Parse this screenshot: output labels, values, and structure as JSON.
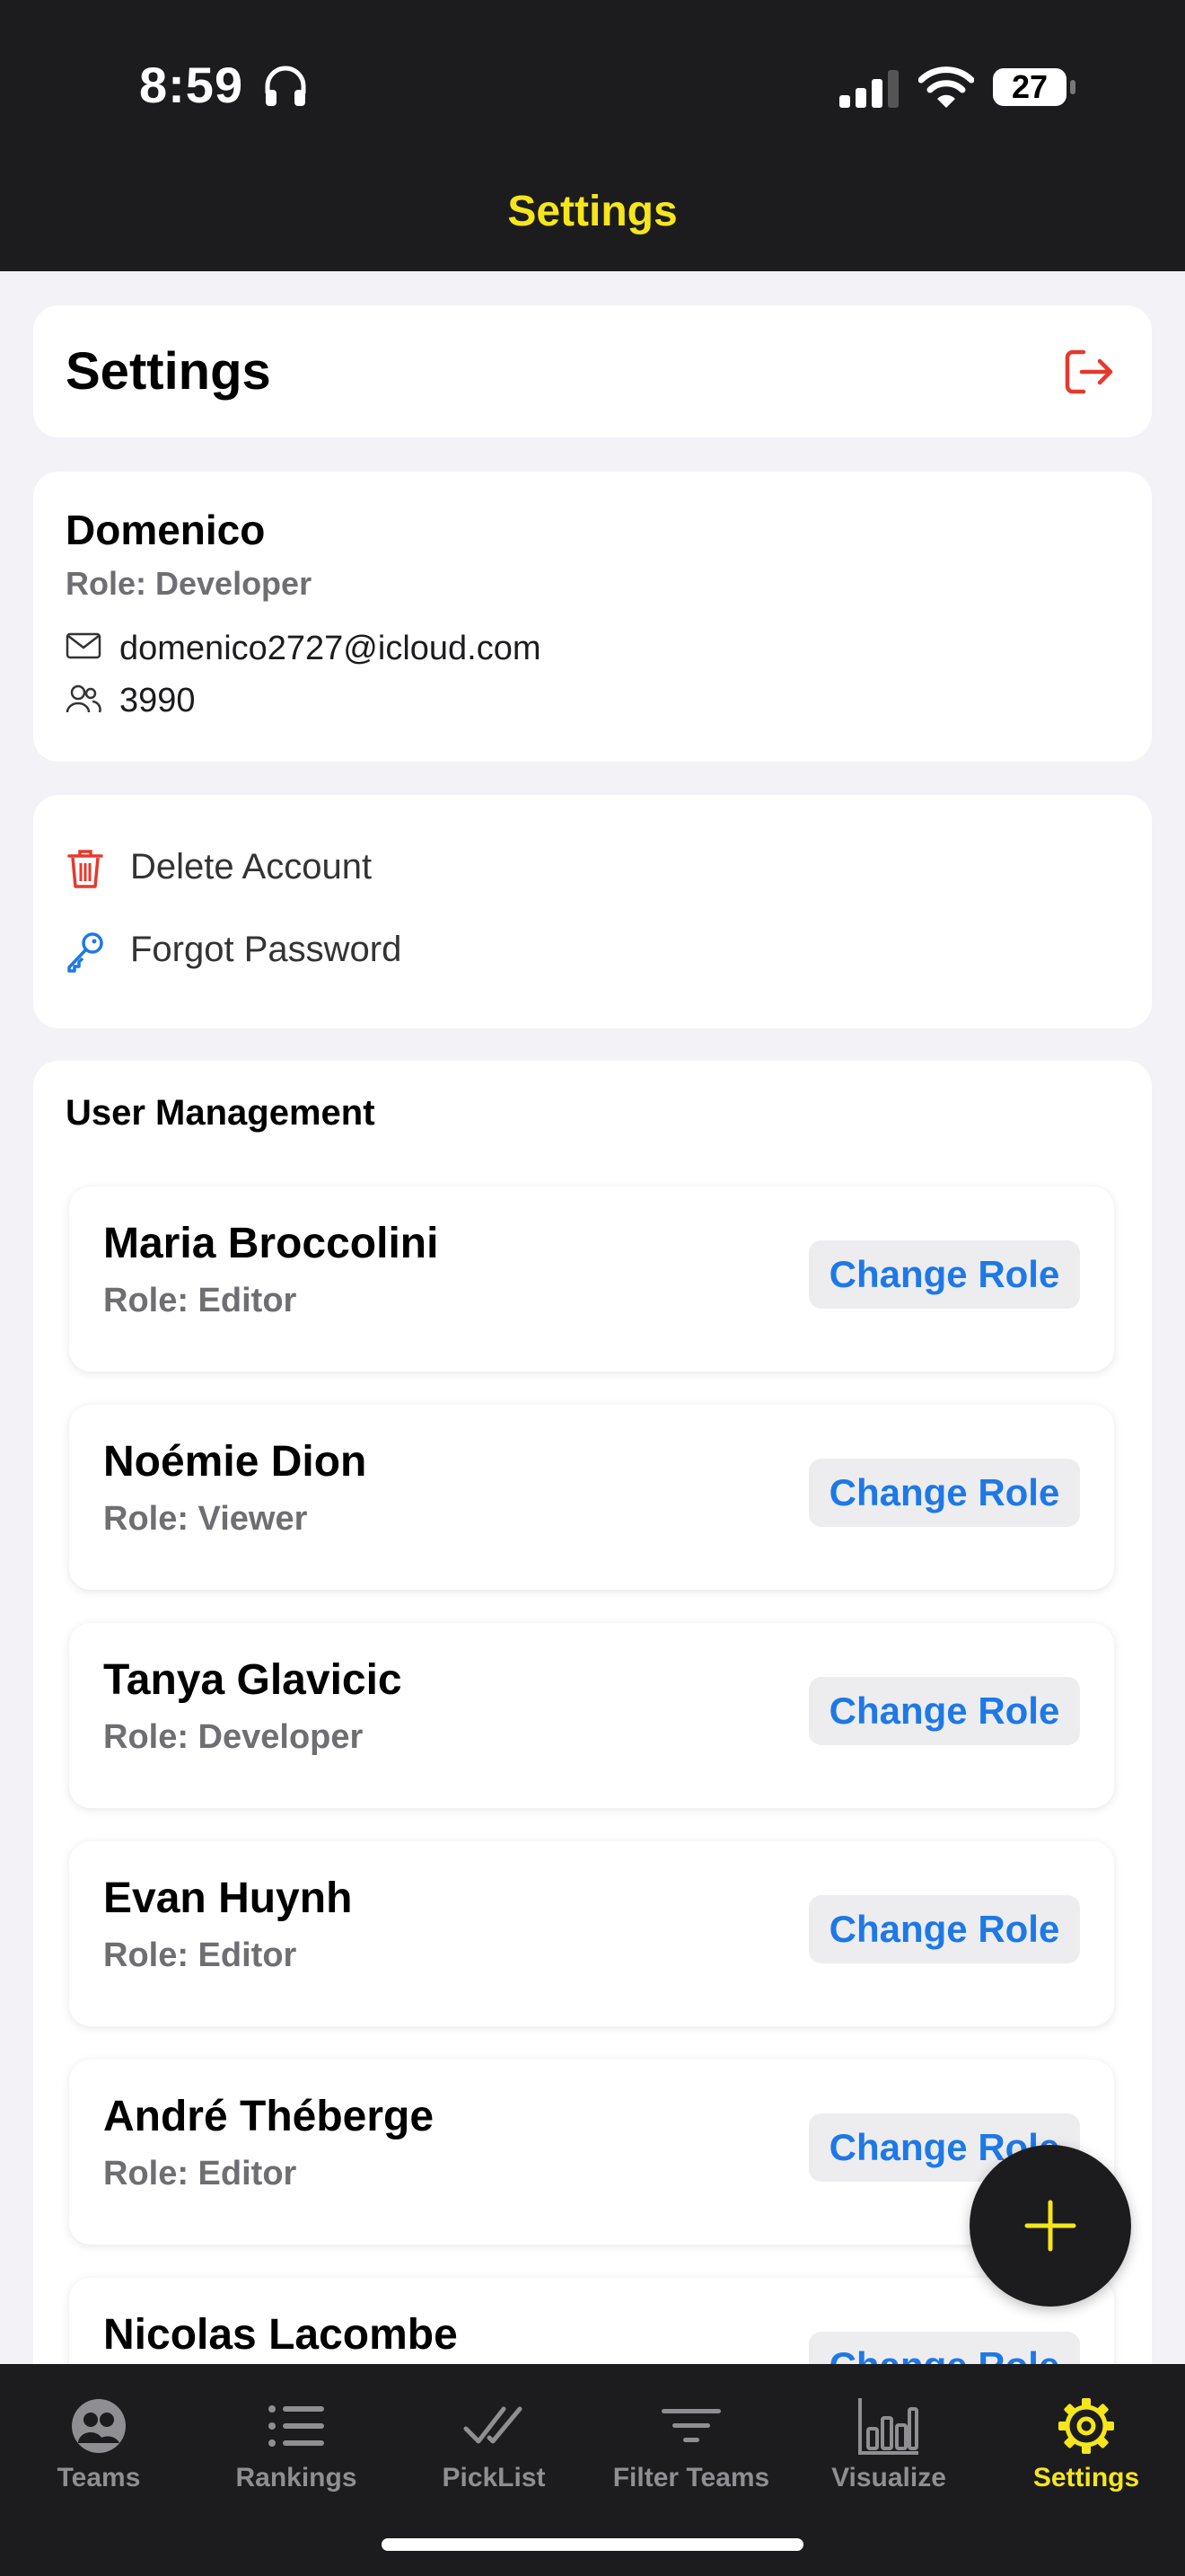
{
  "status_bar": {
    "time": "8:59",
    "battery": "27"
  },
  "nav": {
    "title": "Settings"
  },
  "settings_card": {
    "title": "Settings",
    "logout_icon": "logout-icon"
  },
  "profile": {
    "name": "Domenico",
    "role": "Role: Developer",
    "email": "domenico2727@icloud.com",
    "team": "3990"
  },
  "actions": {
    "delete_label": "Delete Account",
    "forgot_label": "Forgot Password"
  },
  "user_management": {
    "title": "User Management",
    "change_role_label": "Change Role",
    "users": [
      {
        "name": "Maria Broccolini",
        "role": "Role: Editor"
      },
      {
        "name": "Noémie Dion",
        "role": "Role: Viewer"
      },
      {
        "name": "Tanya Glavicic",
        "role": "Role: Developer"
      },
      {
        "name": "Evan Huynh",
        "role": "Role: Editor"
      },
      {
        "name": "André Théberge",
        "role": "Role: Editor"
      },
      {
        "name": "Nicolas Lacombe",
        "role": ""
      }
    ]
  },
  "tabs": [
    {
      "label": "Teams",
      "icon": "teams-icon"
    },
    {
      "label": "Rankings",
      "icon": "list-icon"
    },
    {
      "label": "PickList",
      "icon": "checkmarks-icon"
    },
    {
      "label": "Filter Teams",
      "icon": "filter-icon"
    },
    {
      "label": "Visualize",
      "icon": "bar-chart-icon"
    },
    {
      "label": "Settings",
      "icon": "gear-icon",
      "active": true
    }
  ],
  "colors": {
    "accent_yellow": "#f5e61c",
    "link_blue": "#1e78e6",
    "danger_red": "#e5392e",
    "dark_bar": "#1c1c1e"
  }
}
